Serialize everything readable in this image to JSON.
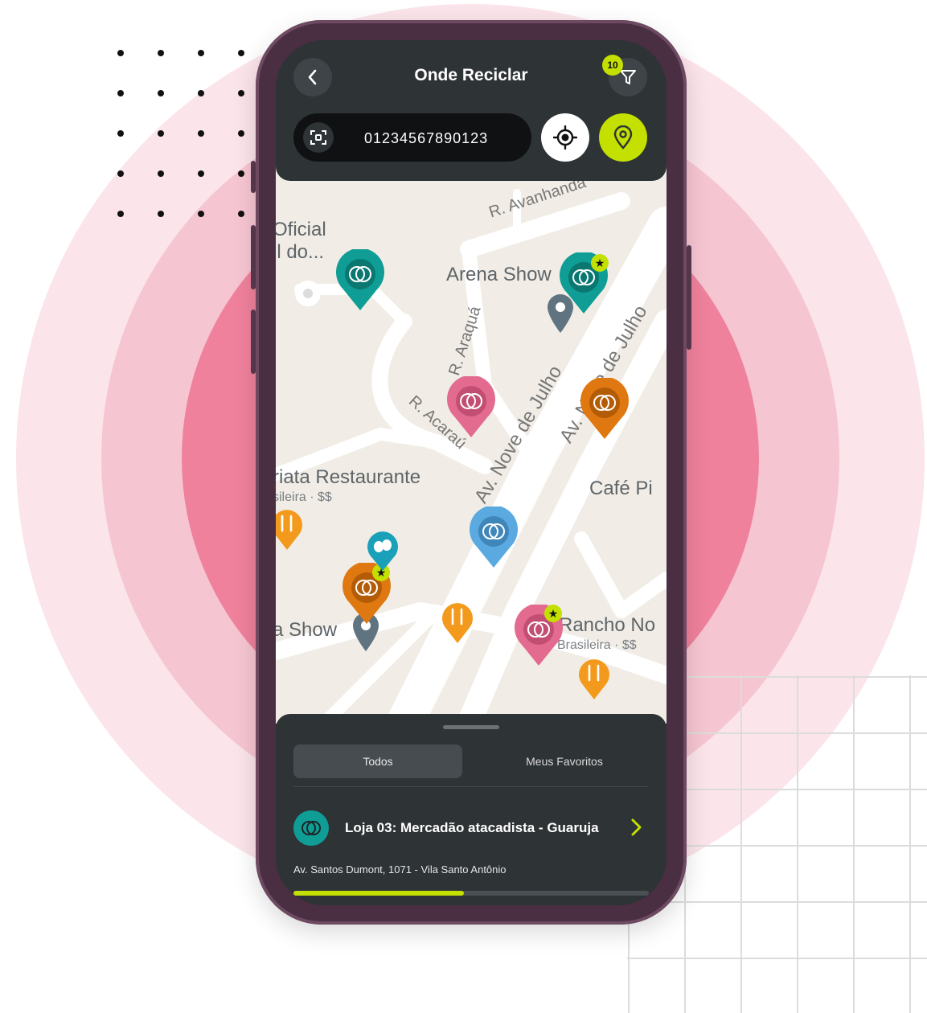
{
  "header": {
    "title": "Onde Reciclar",
    "filter_count": "10"
  },
  "search": {
    "value": "01234567890123"
  },
  "icons": {
    "back": "chevron-left-icon",
    "filter": "filter-funnel-icon",
    "scan": "scan-qr-icon",
    "locate": "crosshair-location-icon",
    "pin": "map-pin-icon",
    "recycle": "recycle-rings-icon",
    "favorite": "star-icon",
    "restaurant": "fork-knife-icon",
    "theater": "theater-masks-icon",
    "chevron": "chevron-right-icon"
  },
  "map": {
    "places": {
      "oficial": "Oficial",
      "oficial_sub": "il do...",
      "arena": "Arena Show",
      "restaurante": "riata Restaurante",
      "restaurante_sub": "sileira · $$",
      "cafe": "Café Pi",
      "show": "a Show",
      "rancho": "Rancho No",
      "rancho_sub": "Brasileira · $$"
    },
    "streets": {
      "avanhandava": "R. Avanhanda",
      "araqua": "R. Araquá",
      "acarau": "R. Acaraú",
      "nove_julho_1": "Av. Nove de Julho",
      "nove_julho_2": "Av. Nove de Julho"
    }
  },
  "sheet": {
    "tabs": [
      "Todos",
      "Meus Favoritos"
    ],
    "active_tab": "Todos",
    "store": {
      "name": "Loja 03: Mercadão atacadista - Guaruja",
      "address": "Av. Santos Dumont, 1071 - Vila Santo Antônio"
    },
    "progress": 0.48
  },
  "colors": {
    "accent": "#c3e000",
    "teal": "#0f9d95",
    "pink": "#e26b8f",
    "orange": "#e07812",
    "blue": "#5aa9e0",
    "food": "#f39a1d",
    "dark": "#2e3336"
  }
}
